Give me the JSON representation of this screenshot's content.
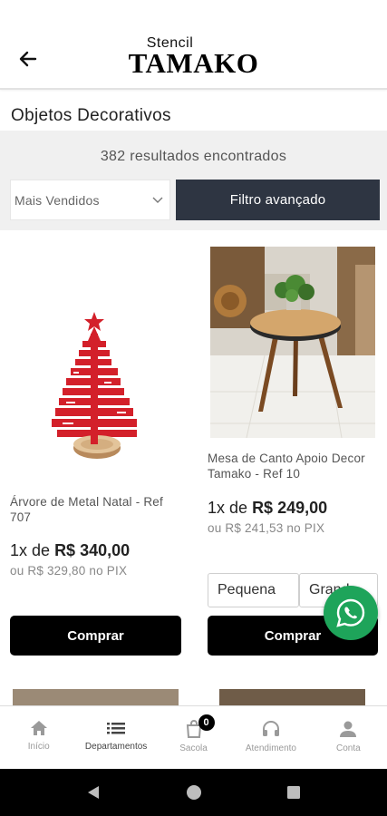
{
  "header": {
    "logo_small": "Stencil",
    "logo_big": "TAMAKO"
  },
  "page_title": "Objetos Decorativos",
  "filters": {
    "results_count": "382 resultados encontrados",
    "sort_value": "Mais Vendidos",
    "advanced_filter_label": "Filtro avançado"
  },
  "products": [
    {
      "name": "Árvore de Metal Natal - Ref 707",
      "price_prefix": "1x de",
      "price": "R$ 340,00",
      "pix_price": "ou R$ 329,80 no PIX",
      "buy_label": "Comprar"
    },
    {
      "name": "Mesa de Canto Apoio Decor Tamako - Ref 10",
      "price_prefix": "1x de",
      "price": "R$ 249,00",
      "pix_price": "ou R$ 241,53 no PIX",
      "variants": [
        "Pequena",
        "Grande"
      ],
      "buy_label": "Comprar"
    }
  ],
  "bottom_nav": [
    {
      "label": "Início",
      "icon": "home-icon"
    },
    {
      "label": "Departamentos",
      "icon": "list-icon",
      "active": true
    },
    {
      "label": "Sacola",
      "icon": "bag-icon",
      "badge": "0"
    },
    {
      "label": "Atendimento",
      "icon": "headset-icon"
    },
    {
      "label": "Conta",
      "icon": "person-icon"
    }
  ],
  "colors": {
    "filter_button_bg": "#2e3542",
    "buy_button_bg": "#000000",
    "whatsapp_green": "#1ea45a",
    "tree_red": "#d3202a"
  }
}
